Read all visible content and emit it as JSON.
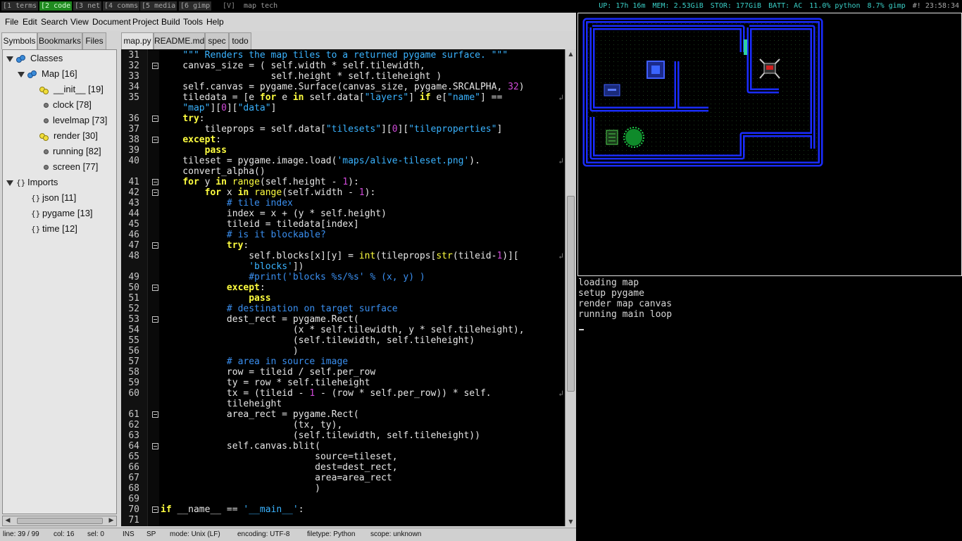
{
  "topbar": {
    "workspaces": [
      {
        "label": "1 terms",
        "active": false
      },
      {
        "label": "2 code",
        "active": true
      },
      {
        "label": "3 net",
        "active": false
      },
      {
        "label": "4 comms",
        "active": false
      },
      {
        "label": "5 media",
        "active": false
      },
      {
        "label": "6 gimp",
        "active": false
      }
    ],
    "layout_mode": "[V]",
    "window_title": "map tech",
    "uptime": "UP: 17h 16m",
    "memory": "MEM: 2.53GiB",
    "storage": "STOR: 177GiB",
    "battery": "BATT: AC",
    "proc1": "11.0% python",
    "proc2": "8.7% gimp",
    "clock": "#! 23:58:34"
  },
  "menu": {
    "file": "File",
    "edit": "Edit",
    "search": "Search",
    "view": "View",
    "document": "Document",
    "project": "Project",
    "build": "Build",
    "tools": "Tools",
    "help": "Help"
  },
  "sidebar": {
    "tabs": {
      "symbols": "Symbols",
      "bookmarks": "Bookmarks",
      "files": "Files"
    },
    "classes_label": "Classes",
    "map_label": "Map [16]",
    "methods": [
      {
        "label": "__init__ [19]",
        "kind": "function"
      },
      {
        "label": "clock [78]",
        "kind": "variable"
      },
      {
        "label": "levelmap [73]",
        "kind": "variable"
      },
      {
        "label": "render [30]",
        "kind": "function"
      },
      {
        "label": "running [82]",
        "kind": "variable"
      },
      {
        "label": "screen [77]",
        "kind": "variable"
      }
    ],
    "imports_label": "Imports",
    "imports": [
      "json [11]",
      "pygame [13]",
      "time [12]"
    ]
  },
  "doc_tabs": [
    "map.py",
    "README.md",
    "spec",
    "todo"
  ],
  "code": {
    "lines": [
      {
        "n": "31",
        "fold": false,
        "html": "    <span class='s'>\"\"\" Renders the map tiles to a returned pygame surface. \"\"\"</span>"
      },
      {
        "n": "32",
        "fold": true,
        "html": "    canvas_size = ( self.width * self.tilewidth,"
      },
      {
        "n": "33",
        "fold": false,
        "html": "                    self.height * self.tileheight )"
      },
      {
        "n": "34",
        "fold": false,
        "html": "    self.canvas = pygame.Surface(canvas_size, pygame.SRCALPHA, <span class='n'>32</span>)"
      },
      {
        "n": "35",
        "fold": false,
        "wrap": true,
        "html": "    tiledata = [e <span class='k'>for</span> e <span class='k'>in</span> self.data[<span class='s'>\"layers\"</span>] <span class='k'>if</span> e[<span class='s'>\"name\"</span>] =="
      },
      {
        "n": "",
        "fold": false,
        "html": "    <span class='s'>\"map\"</span>][<span class='n'>0</span>][<span class='s'>\"data\"</span>]"
      },
      {
        "n": "36",
        "fold": true,
        "html": "    <span class='k'>try</span>:"
      },
      {
        "n": "37",
        "fold": false,
        "html": "        tileprops = self.data[<span class='s'>\"tilesets\"</span>][<span class='n'>0</span>][<span class='s'>\"tileproperties\"</span>]"
      },
      {
        "n": "38",
        "fold": true,
        "html": "    <span class='k'>except</span>:"
      },
      {
        "n": "39",
        "fold": false,
        "html": "        <span class='k'>pass</span>"
      },
      {
        "n": "40",
        "fold": false,
        "wrap": true,
        "html": "    tileset = pygame.image.load(<span class='s'>'maps/alive-tileset.png'</span>)."
      },
      {
        "n": "",
        "fold": false,
        "html": "    convert_alpha()"
      },
      {
        "n": "41",
        "fold": true,
        "html": "    <span class='k'>for</span> y <span class='k'>in</span> <span class='b'>range</span>(self.height - <span class='n'>1</span>):"
      },
      {
        "n": "42",
        "fold": true,
        "html": "        <span class='k'>for</span> x <span class='k'>in</span> <span class='b'>range</span>(self.width - <span class='n'>1</span>):"
      },
      {
        "n": "43",
        "fold": false,
        "html": "            <span class='c'># tile index</span>"
      },
      {
        "n": "44",
        "fold": false,
        "html": "            index = x + (y * self.height)"
      },
      {
        "n": "45",
        "fold": false,
        "html": "            tileid = tiledata[index]"
      },
      {
        "n": "46",
        "fold": false,
        "html": "            <span class='c'># is it blockable?</span>"
      },
      {
        "n": "47",
        "fold": true,
        "html": "            <span class='k'>try</span>:"
      },
      {
        "n": "48",
        "fold": false,
        "wrap": true,
        "html": "                self.blocks[x][y] = <span class='b'>int</span>(tileprops[<span class='b'>str</span>(tileid-<span class='n'>1</span>)]["
      },
      {
        "n": "",
        "fold": false,
        "html": "                <span class='s'>'blocks'</span>])"
      },
      {
        "n": "49",
        "fold": false,
        "html": "                <span class='c'>#print('blocks %s/%s' % (x, y) )</span>"
      },
      {
        "n": "50",
        "fold": true,
        "html": "            <span class='k'>except</span>:"
      },
      {
        "n": "51",
        "fold": false,
        "html": "                <span class='k'>pass</span>"
      },
      {
        "n": "52",
        "fold": false,
        "html": "            <span class='c'># destination on target surface</span>"
      },
      {
        "n": "53",
        "fold": true,
        "html": "            dest_rect = pygame.Rect("
      },
      {
        "n": "54",
        "fold": false,
        "html": "                        (x * self.tilewidth, y * self.tileheight),"
      },
      {
        "n": "55",
        "fold": false,
        "html": "                        (self.tilewidth, self.tileheight)"
      },
      {
        "n": "56",
        "fold": false,
        "html": "                        )"
      },
      {
        "n": "57",
        "fold": false,
        "html": "            <span class='c'># area in source image</span>"
      },
      {
        "n": "58",
        "fold": false,
        "html": "            row = tileid / self.per_row"
      },
      {
        "n": "59",
        "fold": false,
        "html": "            ty = row * self.tileheight"
      },
      {
        "n": "60",
        "fold": false,
        "wrap": true,
        "html": "            tx = (tileid - <span class='n'>1</span> - (row * self.per_row)) * self."
      },
      {
        "n": "",
        "fold": false,
        "html": "            tileheight"
      },
      {
        "n": "61",
        "fold": true,
        "html": "            area_rect = pygame.Rect("
      },
      {
        "n": "62",
        "fold": false,
        "html": "                        (tx, ty),"
      },
      {
        "n": "63",
        "fold": false,
        "html": "                        (self.tilewidth, self.tileheight))"
      },
      {
        "n": "64",
        "fold": true,
        "html": "            self.canvas.blit("
      },
      {
        "n": "65",
        "fold": false,
        "html": "                            source=tileset,"
      },
      {
        "n": "66",
        "fold": false,
        "html": "                            dest=dest_rect,"
      },
      {
        "n": "67",
        "fold": false,
        "html": "                            area=area_rect"
      },
      {
        "n": "68",
        "fold": false,
        "html": "                            )"
      },
      {
        "n": "69",
        "fold": false,
        "html": ""
      },
      {
        "n": "70",
        "fold": true,
        "html": "<span class='k'>if</span> __name__ == <span class='s'>'__main__'</span>:"
      },
      {
        "n": "71",
        "fold": false,
        "html": ""
      }
    ]
  },
  "statusbar": {
    "line": "line: 39 / 99",
    "col": "col: 16",
    "sel": "sel: 0",
    "ins": "INS",
    "sp": "SP",
    "mode": "mode: Unix (LF)",
    "encoding": "encoding: UTF-8",
    "filetype": "filetype: Python",
    "scope": "scope: unknown"
  },
  "terminal": {
    "lines": [
      "loading map",
      "setup pygame",
      "render map canvas",
      "running main loop"
    ]
  },
  "colors": {
    "workspace_active": "#1f8a1f",
    "stats": "#3ad0c8",
    "keyword": "#ffff40",
    "string": "#3ab3ff",
    "comment": "#3a8ff0",
    "number": "#d04ad8",
    "wall": "#1a2cff"
  }
}
